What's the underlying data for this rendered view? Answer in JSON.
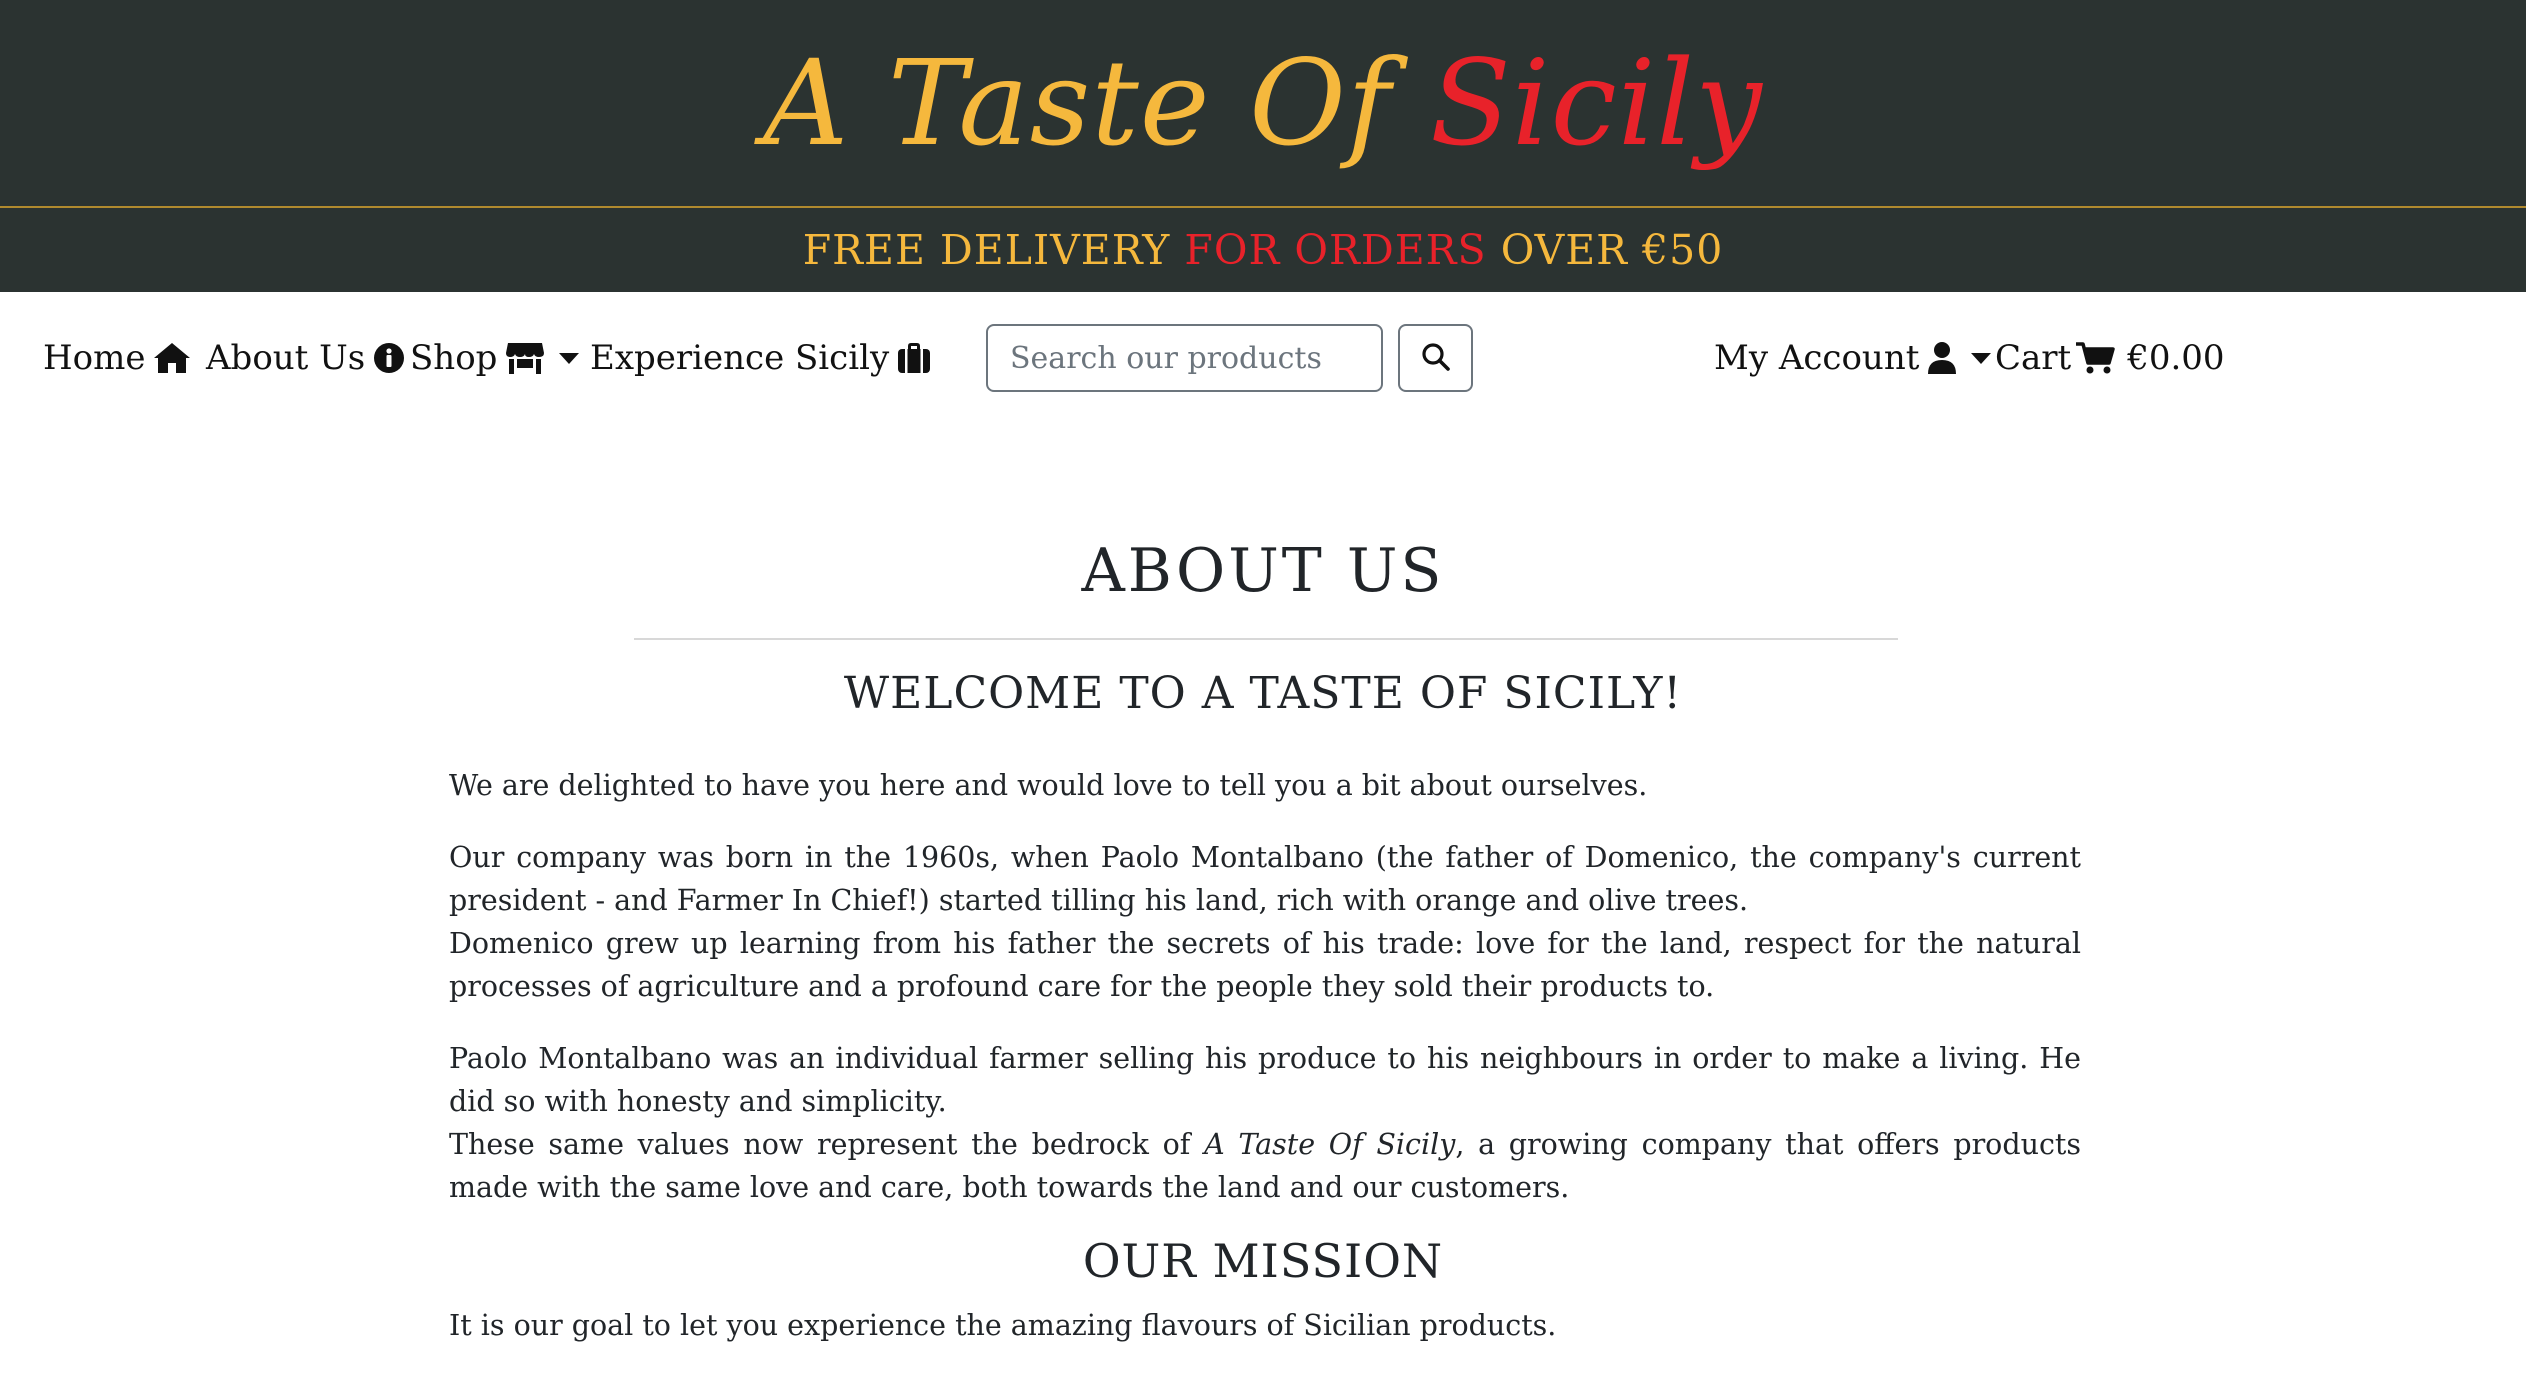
{
  "brand": {
    "part1": "A Taste Of",
    "part2": "Sicily"
  },
  "delivery": {
    "part1": "FREE DELIVERY",
    "part2": "FOR ORDERS",
    "part3": "OVER €50"
  },
  "nav": {
    "home": "Home",
    "about": "About Us",
    "shop": "Shop",
    "experience": "Experience Sicily",
    "account": "My Account",
    "cart": "Cart",
    "cart_total": "€0.00"
  },
  "search": {
    "placeholder": "Search our products",
    "value": ""
  },
  "content": {
    "title": "ABOUT US",
    "welcome": "WELCOME TO A TASTE OF SICILY!",
    "p1": "We are delighted to have you here and would love to tell you a bit about ourselves.",
    "p2a": "Our company was born in the 1960s, when Paolo Montalbano (the father of Domenico, the company's current president - and Farmer In Chief!) started tilling his land, rich with orange and olive trees.",
    "p2b": "Domenico grew up learning from his father the secrets of his trade: love for the land, respect for the natural processes of agriculture and a profound care for the people they sold their products to.",
    "p3a": "Paolo Montalbano was an individual farmer selling his produce to his neighbours in order to make a living. He did so with honesty and simplicity.",
    "p3b_pre": "These same values now represent the bedrock of ",
    "p3b_em": "A Taste Of Sicily",
    "p3b_post": ", a growing company that offers products made with the same love and care, both towards the land and our customers.",
    "mission_title": "OUR MISSION",
    "mission_text": "It is our goal to let you experience the amazing flavours of Sicilian products."
  },
  "colors": {
    "header_bg": "#2b3331",
    "gold": "#f5b83d",
    "red": "#e8222a"
  },
  "icons": [
    "home-icon",
    "info-icon",
    "store-icon",
    "suitcase-icon",
    "search-icon",
    "user-icon",
    "cart-icon"
  ]
}
